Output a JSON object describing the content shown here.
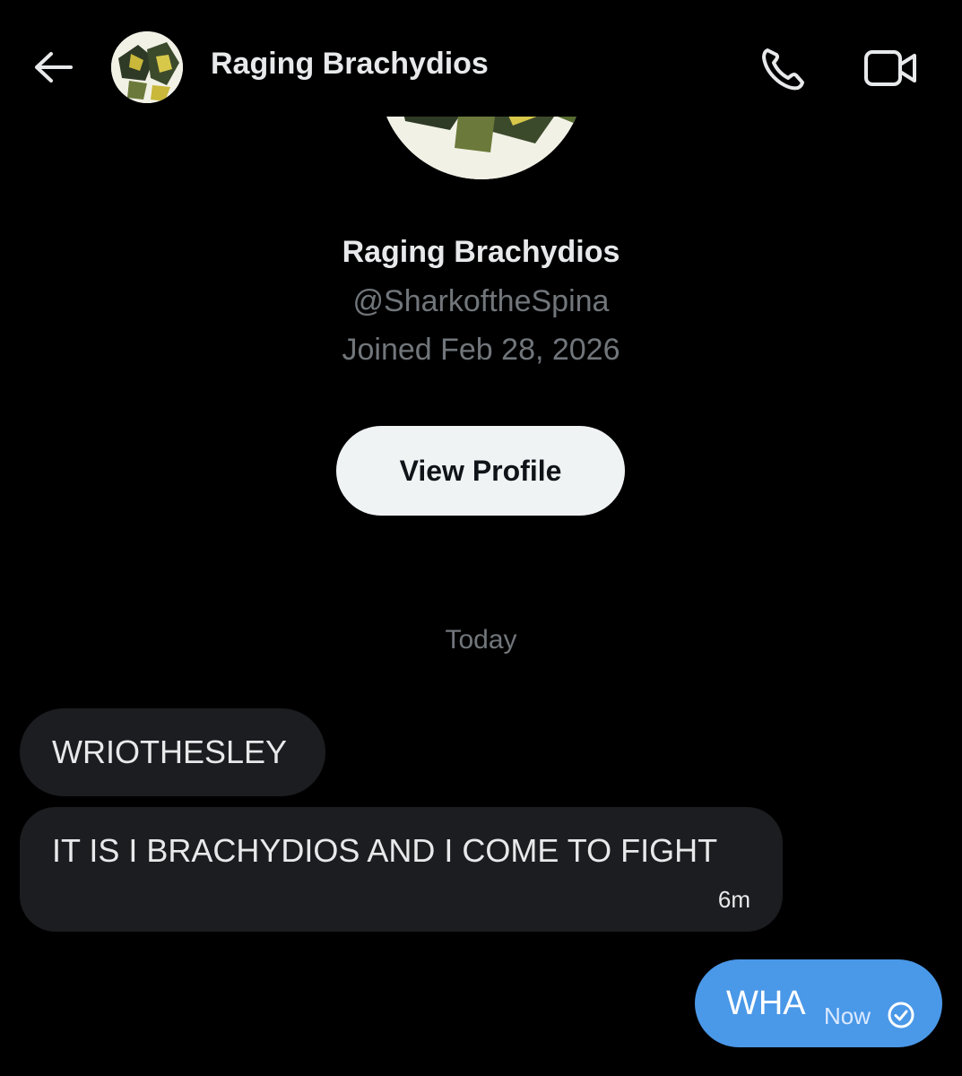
{
  "header": {
    "title": "Raging Brachydios",
    "back_icon": "arrow-left-icon",
    "call_icon": "phone-icon",
    "video_icon": "video-camera-icon"
  },
  "profile": {
    "name": "Raging Brachydios",
    "handle": "@SharkoftheSpina",
    "joined": "Joined Feb 28, 2026",
    "view_profile_label": "View Profile"
  },
  "conversation": {
    "day_label": "Today",
    "messages": [
      {
        "direction": "incoming",
        "text": "WRIOTHESLEY"
      },
      {
        "direction": "incoming",
        "text": "IT IS I BRACHYDIOS AND I COME TO FIGHT",
        "time": "6m"
      },
      {
        "direction": "outgoing",
        "text": "WHA",
        "time": "Now",
        "status_icon": "check-circle-icon"
      }
    ]
  },
  "colors": {
    "background": "#000000",
    "incoming_bubble": "#1c1d20",
    "outgoing_bubble": "#4a98e8",
    "button_bg": "#eff3f4",
    "muted_text": "#71767b"
  }
}
